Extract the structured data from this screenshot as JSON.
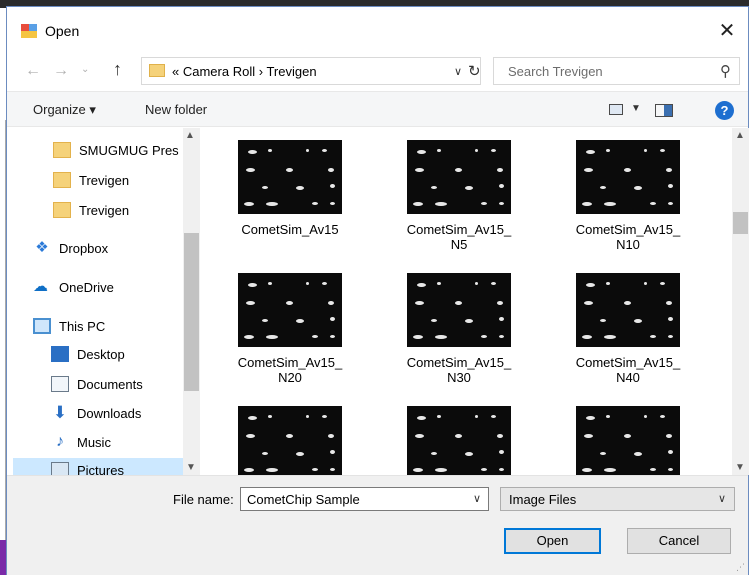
{
  "window": {
    "title": "Open",
    "close_glyph": "✕"
  },
  "address": {
    "overflow": "«",
    "crumbs": [
      "Camera Roll",
      "Trevigen"
    ],
    "separator": "›",
    "search_placeholder": "Search Trevigen"
  },
  "toolbar": {
    "organize_label": "Organize ▾",
    "new_folder_label": "New folder",
    "help_glyph": "?"
  },
  "nav": {
    "items": [
      {
        "label": "SMUGMUG Pres",
        "icon": "folder-icon"
      },
      {
        "label": "Trevigen",
        "icon": "folder-icon"
      },
      {
        "label": "Trevigen",
        "icon": "folder-icon"
      },
      {
        "label": "Dropbox",
        "icon": "dropbox-icon"
      },
      {
        "label": "OneDrive",
        "icon": "onedrive-icon"
      },
      {
        "label": "This PC",
        "icon": "computer-icon"
      },
      {
        "label": "Desktop",
        "icon": "desktop-icon"
      },
      {
        "label": "Documents",
        "icon": "documents-icon"
      },
      {
        "label": "Downloads",
        "icon": "downloads-icon"
      },
      {
        "label": "Music",
        "icon": "music-icon"
      },
      {
        "label": "Pictures",
        "icon": "pictures-icon",
        "selected": true
      }
    ]
  },
  "files": [
    {
      "line1": "CometSim_Av15",
      "line2": ""
    },
    {
      "line1": "CometSim_Av15_",
      "line2": "N5"
    },
    {
      "line1": "CometSim_Av15_",
      "line2": "N10"
    },
    {
      "line1": "CometSim_Av15_",
      "line2": "N20"
    },
    {
      "line1": "CometSim_Av15_",
      "line2": "N30"
    },
    {
      "line1": "CometSim_Av15_",
      "line2": "N40"
    },
    {
      "line1": "",
      "line2": ""
    },
    {
      "line1": "",
      "line2": ""
    },
    {
      "line1": "",
      "line2": ""
    }
  ],
  "footer": {
    "file_name_label": "File name:",
    "file_name_value": "CometChip Sample",
    "file_type_value": "Image Files",
    "open_label": "Open",
    "cancel_label": "Cancel"
  },
  "colors": {
    "accent": "#0078d7",
    "selection": "#cce8ff",
    "folder": "#f5d27a"
  }
}
